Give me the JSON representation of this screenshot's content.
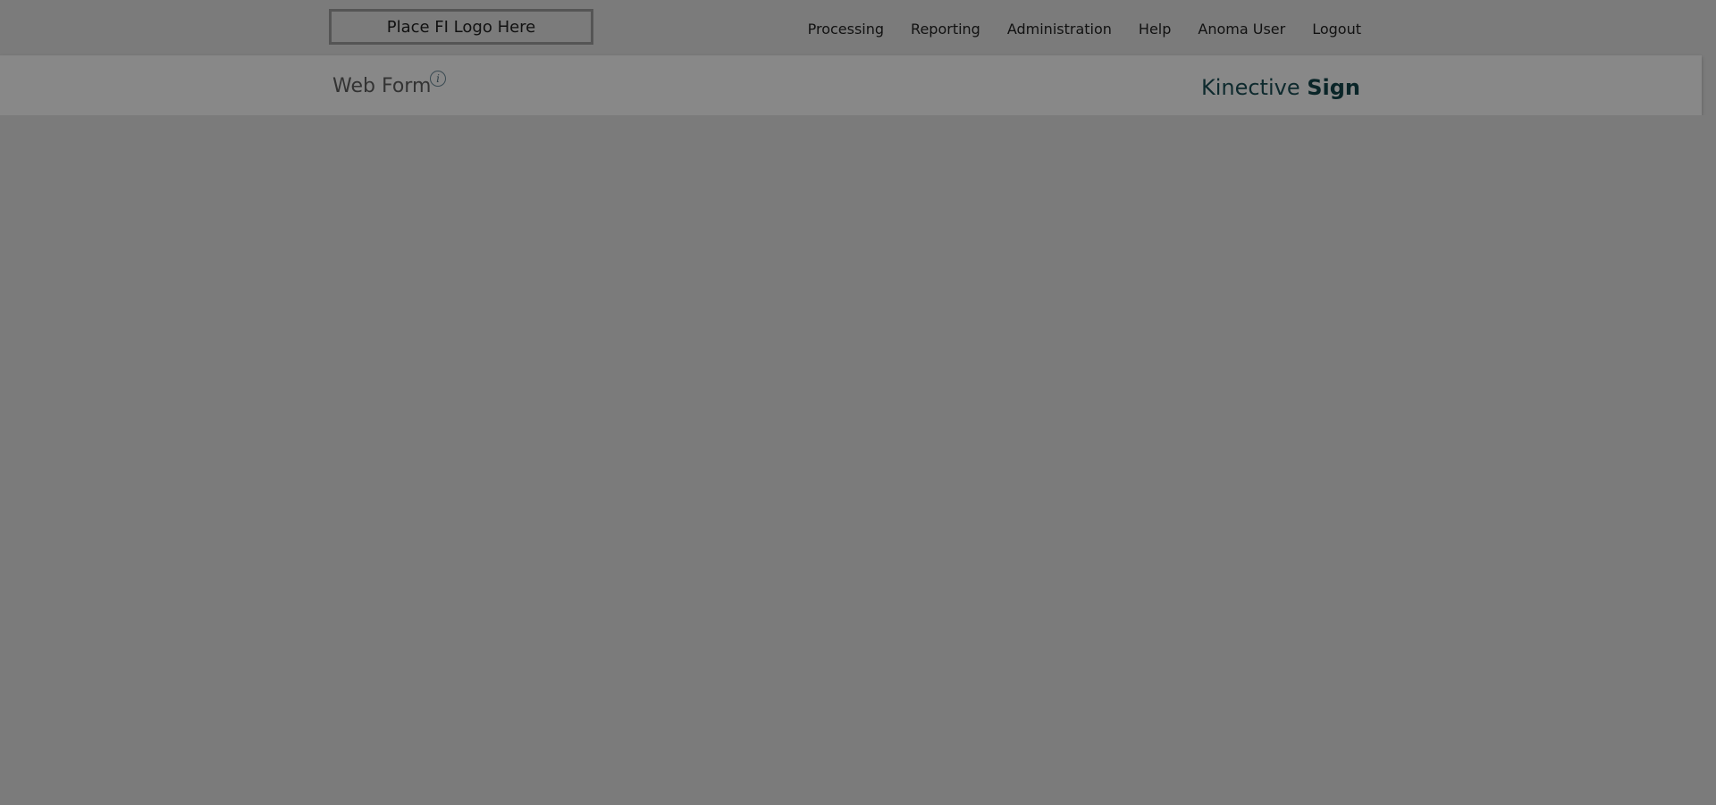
{
  "header": {
    "logo_text": "Place FI Logo Here",
    "nav": [
      {
        "label": "Processing"
      },
      {
        "label": "Reporting"
      },
      {
        "label": "Administration"
      },
      {
        "label": "Help"
      },
      {
        "label": "Anoma User"
      },
      {
        "label": "Logout"
      }
    ]
  },
  "subheader": {
    "page_title": "Web Form",
    "info_icon": "info-icon",
    "brand_light": "Kinective ",
    "brand_bold": "Sign"
  },
  "colors": {
    "overlay_background": "#7b7b7b",
    "brand_text": "#0e2a2e"
  }
}
